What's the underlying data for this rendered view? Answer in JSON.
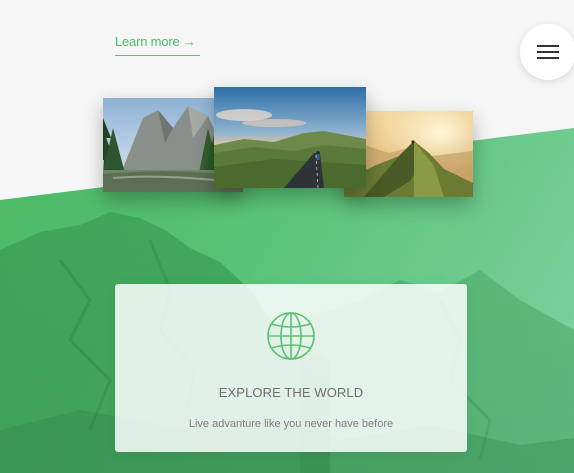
{
  "nav": {
    "learn_more_label": "Learn more →",
    "menu_icon": "hamburger-menu-icon"
  },
  "gallery": {
    "photos": [
      {
        "subject": "valley with pine trees and granite cliffs"
      },
      {
        "subject": "cyclist on road through green hills at sunset"
      },
      {
        "subject": "hiker on mountain ridge at sunrise"
      }
    ]
  },
  "feature_card": {
    "icon": "globe-icon",
    "title": "EXPLORE THE WORLD",
    "subtitle": "Live advanture like you never have before"
  },
  "colors": {
    "accent_green": "#4cba66",
    "hero_gradient_start": "#46b65e",
    "hero_gradient_end": "#7fd3a3",
    "page_background": "#f6f6f6"
  }
}
